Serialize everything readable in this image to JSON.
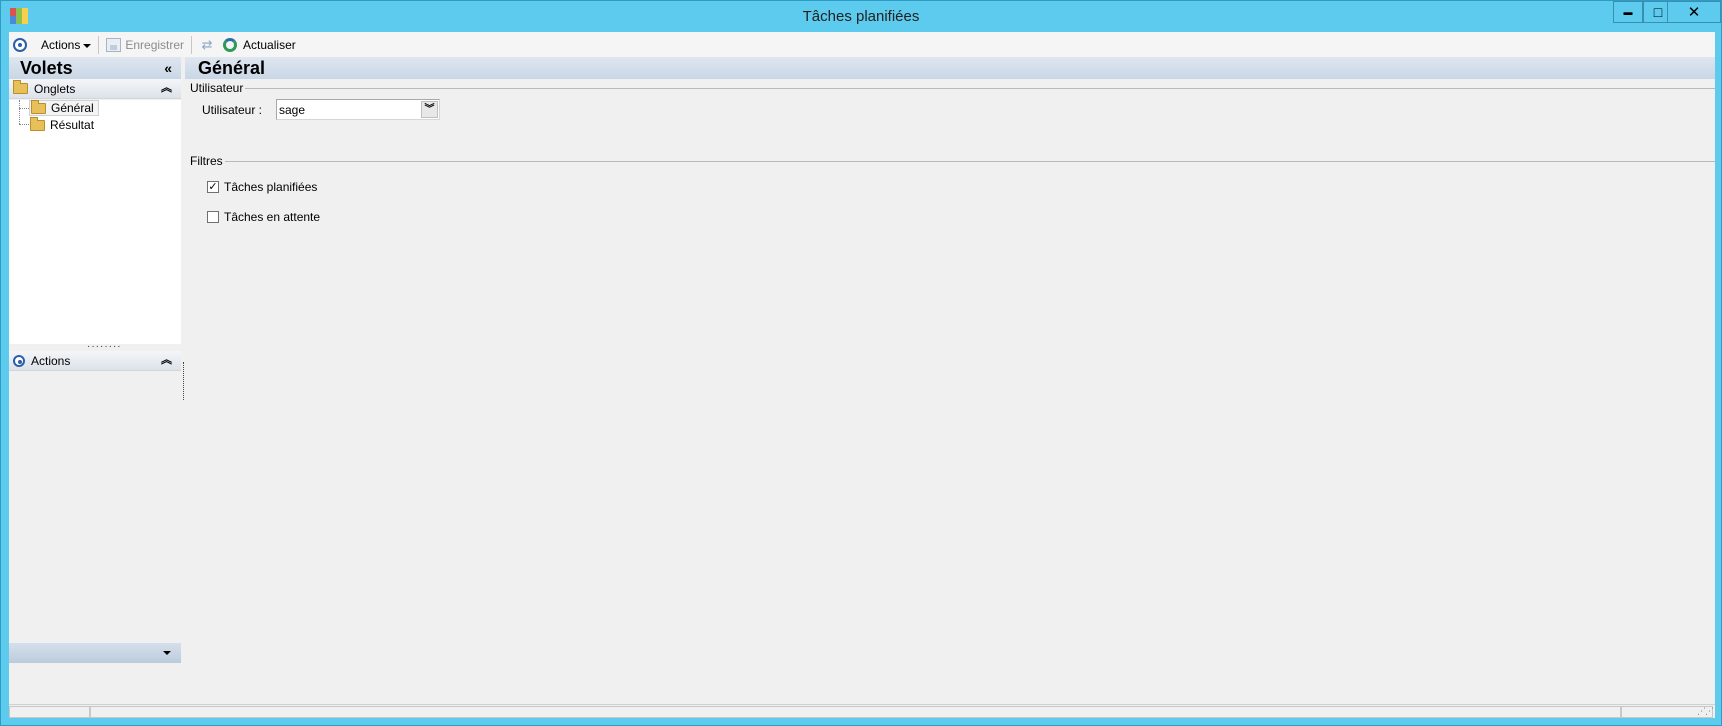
{
  "window": {
    "title": "Tâches planifiées",
    "minimize_glyph": "▬",
    "maximize_glyph": "□",
    "close_glyph": "✕"
  },
  "toolbar": {
    "actions_label": "Actions",
    "save_label": "Enregistrer",
    "refresh_label": "Actualiser"
  },
  "sidebar": {
    "title": "Volets",
    "collapse_glyph": "«",
    "tabs_section": {
      "label": "Onglets",
      "items": [
        {
          "label": "Général",
          "selected": true
        },
        {
          "label": "Résultat",
          "selected": false
        }
      ]
    },
    "actions_section": {
      "label": "Actions"
    }
  },
  "main": {
    "title": "Général",
    "user_group": {
      "label": "Utilisateur",
      "field_label": "Utilisateur :",
      "field_value": "sage"
    },
    "filters_group": {
      "label": "Filtres",
      "items": [
        {
          "label": "Tâches planifiées",
          "checked": true
        },
        {
          "label": "Tâches en attente",
          "checked": false
        }
      ]
    }
  },
  "colors": {
    "title_bar": "#5ccbee",
    "client_bg": "#f0f0f0",
    "header_gradient_top": "#dfe7f0",
    "header_gradient_bottom": "#c9d6e5",
    "accent_blue": "#2b5fa8"
  },
  "icons": {
    "app": "app-tiles-icon",
    "actions": "ring-icon",
    "save": "save-icon",
    "sync": "sync-icon",
    "refresh": "refresh-icon",
    "folder": "folder-icon"
  }
}
